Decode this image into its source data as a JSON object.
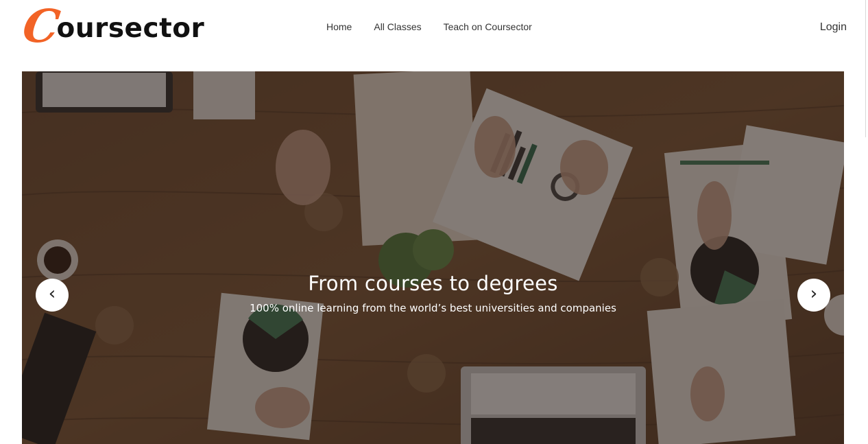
{
  "logo": {
    "initial": "C",
    "rest": "oursector",
    "accent_color": "#f26326"
  },
  "nav": {
    "items": [
      {
        "label": "Home"
      },
      {
        "label": "All Classes"
      },
      {
        "label": "Teach on Coursector"
      }
    ]
  },
  "header": {
    "login_label": "Login"
  },
  "hero": {
    "title": "From courses to degrees",
    "subtitle": "100% online learning from the world’s best universities and companies",
    "prev_icon": "‹",
    "next_icon": "›"
  }
}
